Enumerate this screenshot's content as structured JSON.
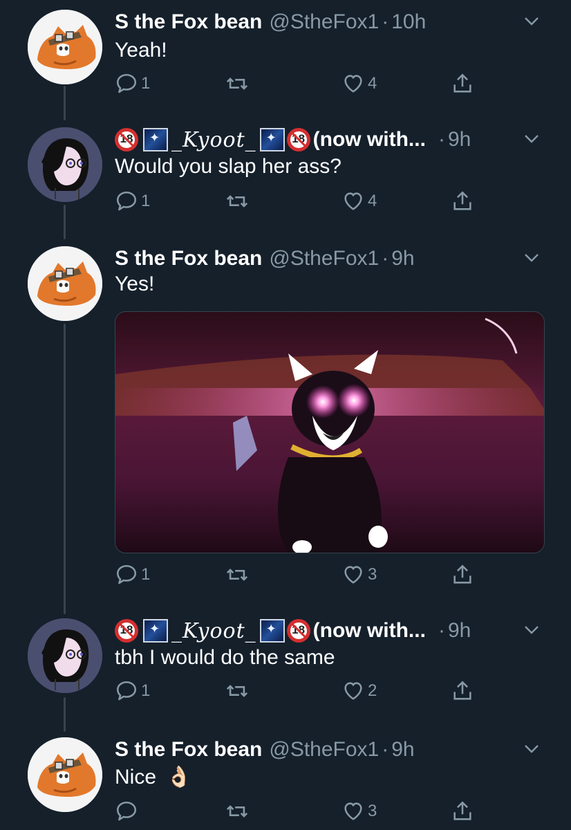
{
  "tweets": [
    {
      "author": "S the Fox bean",
      "handle": "@StheFox1",
      "separator": "·",
      "time": "10h",
      "text": "Yeah!",
      "replies": "1",
      "retweets": "",
      "likes": "4"
    },
    {
      "author_prefix_badge": "18",
      "author": "_Kyoot_",
      "author_suffix_badge": "18",
      "author_suffix": "(now with...",
      "separator": "·",
      "time": "9h",
      "text": "Would you slap her ass?",
      "replies": "1",
      "retweets": "",
      "likes": "4"
    },
    {
      "author": "S the Fox bean",
      "handle": "@StheFox1",
      "separator": "·",
      "time": "9h",
      "text": "Yes!",
      "has_media": true,
      "replies": "1",
      "retweets": "",
      "likes": "3"
    },
    {
      "author_prefix_badge": "18",
      "author": "_Kyoot_",
      "author_suffix_badge": "18",
      "author_suffix": "(now with...",
      "separator": "·",
      "time": "9h",
      "text": "tbh I would do the same",
      "replies": "1",
      "retweets": "",
      "likes": "2"
    },
    {
      "author": "S the Fox bean",
      "handle": "@StheFox1",
      "separator": "·",
      "time": "9h",
      "text": "Nice",
      "emoji": "👌🏻",
      "replies": "",
      "retweets": "",
      "likes": "3"
    }
  ],
  "icons": {
    "reply": "reply-icon",
    "retweet": "retweet-icon",
    "like": "heart-icon",
    "share": "share-icon",
    "caret": "chevron-down-icon"
  },
  "colors": {
    "background": "#15202b",
    "secondary_text": "#8899a6",
    "thread_line": "#38444d"
  }
}
